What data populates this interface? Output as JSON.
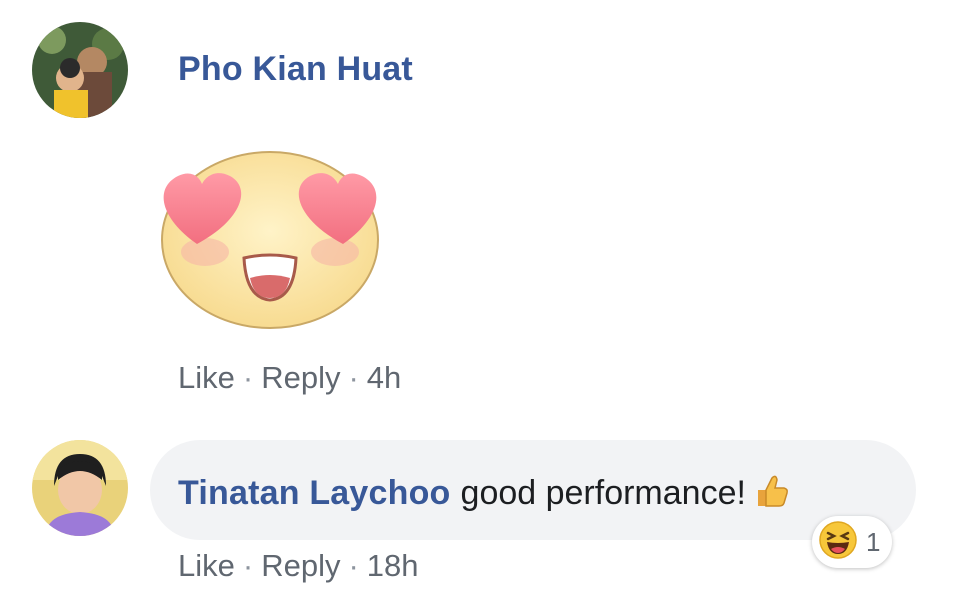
{
  "comments": [
    {
      "author": "Pho Kian Huat",
      "sticker": "heart-eyes-face-sticker",
      "actions": {
        "like": "Like",
        "reply": "Reply",
        "separator": "·",
        "time": "4h"
      }
    },
    {
      "author": "Tinatan Laychoo",
      "text": "good performance!",
      "text_emoji": "thumbs-up-icon",
      "reaction": {
        "icon": "laughing-face-icon",
        "count": "1"
      },
      "actions": {
        "like": "Like",
        "reply": "Reply",
        "separator": "·",
        "time": "18h"
      }
    }
  ],
  "colors": {
    "author": "#385898",
    "meta": "#606770",
    "bubble": "#f2f3f5"
  }
}
